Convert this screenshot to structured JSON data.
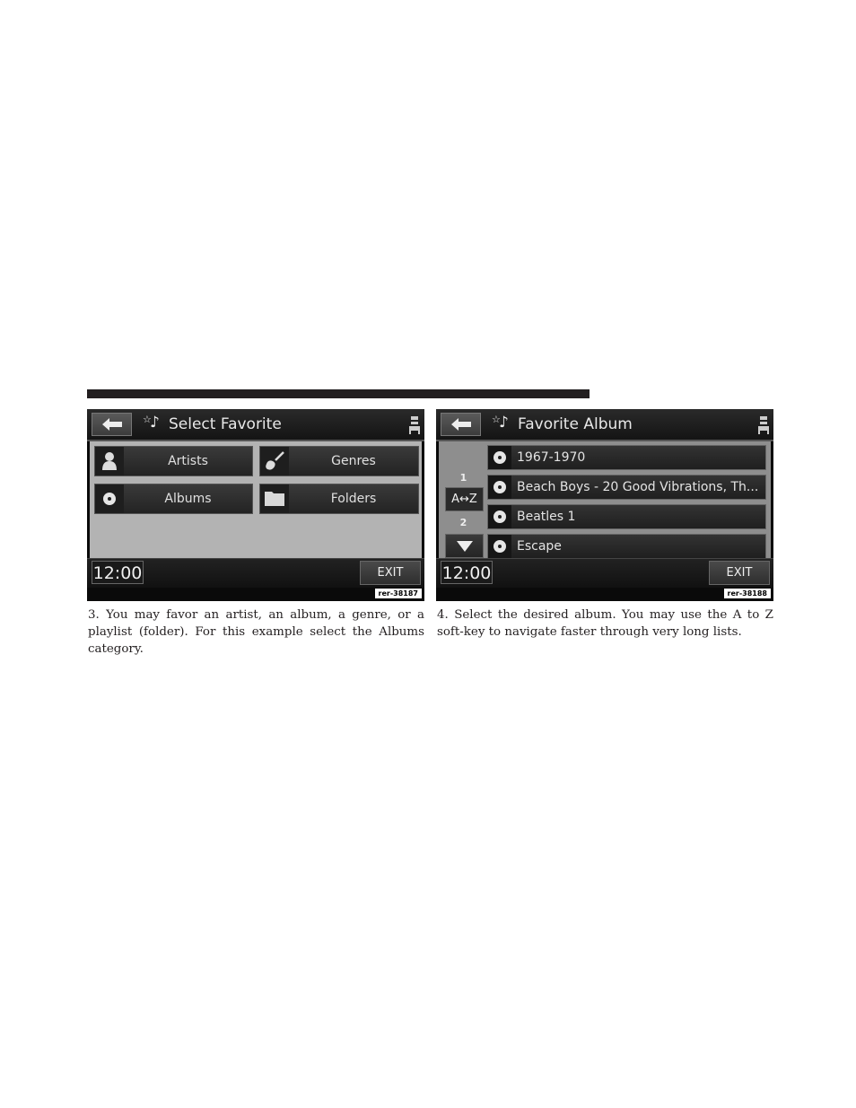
{
  "section_rule_color": "#231f20",
  "screens": [
    {
      "title": "Select Favorite",
      "icons": {
        "back": "back-arrow-icon",
        "title": "star-music-note-icon",
        "status": "seat-icon"
      },
      "tiles": [
        {
          "label": "Artists",
          "icon": "person-icon"
        },
        {
          "label": "Genres",
          "icon": "guitar-icon"
        },
        {
          "label": "Albums",
          "icon": "disc-icon"
        },
        {
          "label": "Folders",
          "icon": "folder-icon"
        }
      ],
      "clock": "12:00",
      "exit_label": "EXIT",
      "ref": "rer-38187"
    },
    {
      "title": "Favorite Album",
      "icons": {
        "back": "back-arrow-icon",
        "title": "star-music-note-icon",
        "status": "seat-icon"
      },
      "side": {
        "page_current": "1",
        "az_label": "A↔Z",
        "page_total": "2",
        "down": "down-arrow-icon"
      },
      "albums": [
        {
          "label": "1967-1970",
          "icon": "disc-icon"
        },
        {
          "label": "Beach Boys - 20 Good Vibrations, Th...",
          "icon": "disc-icon"
        },
        {
          "label": "Beatles 1",
          "icon": "disc-icon"
        },
        {
          "label": "Escape",
          "icon": "disc-icon"
        }
      ],
      "clock": "12:00",
      "exit_label": "EXIT",
      "ref": "rer-38188"
    }
  ],
  "captions": [
    "3. You may favor an artist, an album, a genre, or a playlist (folder). For this example select the Albums category.",
    "4. Select the desired album. You may use the A to Z soft-key to navigate faster through very long lists."
  ]
}
